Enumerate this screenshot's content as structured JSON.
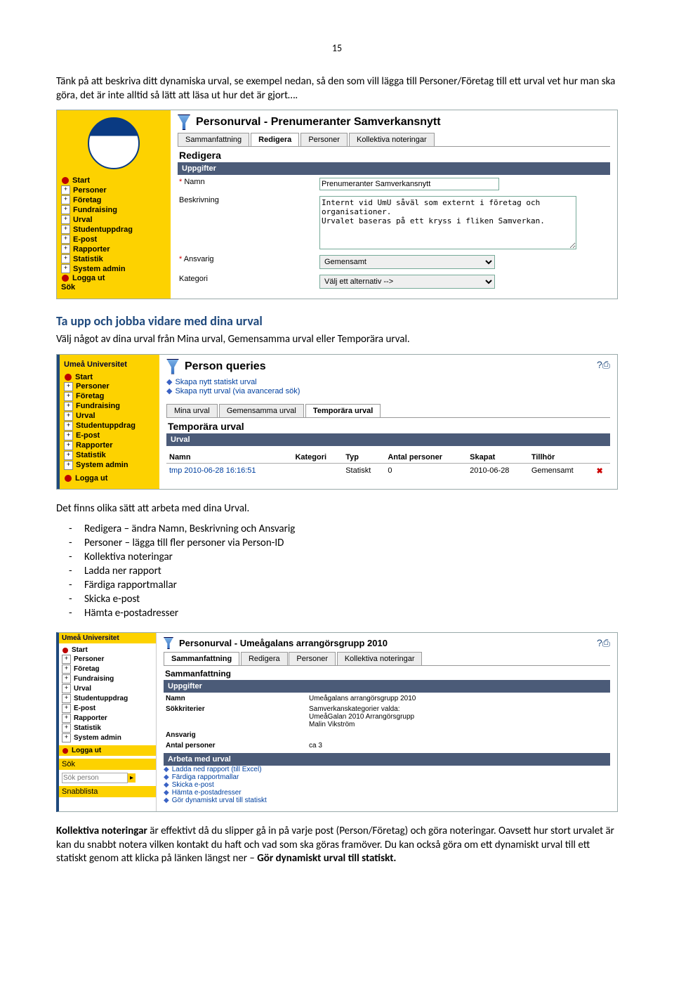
{
  "page_number": "15",
  "intro": "Tänk på att beskriva ditt dynamiska urval, se exempel nedan, så den som vill lägga till Personer/Företag till ett urval vet hur man ska göra, det är inte alltid så lätt att läsa ut hur det är gjort….",
  "shot1": {
    "title": "Personurval - Prenumeranter Samverkansnytt",
    "tabs": [
      "Sammanfattning",
      "Redigera",
      "Personer",
      "Kollektiva noteringar"
    ],
    "active_tab": "Redigera",
    "section": "Redigera",
    "bar": "Uppgifter",
    "form": {
      "namn_label": "Namn",
      "namn_value": "Prenumeranter Samverkansnytt",
      "beskr_label": "Beskrivning",
      "beskr_value": "Internt vid UmU såväl som externt i företag och organisationer.\nUrvalet baseras på ett kryss i fliken Samverkan.",
      "ansv_label": "Ansvarig",
      "ansv_value": "Gemensamt",
      "kat_label": "Kategori",
      "kat_value": "Välj ett alternativ -->"
    },
    "nav": [
      "Start",
      "Personer",
      "Företag",
      "Fundraising",
      "Urval",
      "Studentuppdrag",
      "E-post",
      "Rapporter",
      "Statistik",
      "System admin",
      "Logga ut",
      "Sök"
    ]
  },
  "heading2": "Ta upp och jobba vidare med dina urval",
  "heading2_text": "Välj något av dina urval från Mina urval, Gemensamma urval eller Temporära urval.",
  "shot2": {
    "brand": "Umeå Universitet",
    "title": "Person queries",
    "links": [
      "Skapa nytt statiskt urval",
      "Skapa nytt urval (via avancerad sök)"
    ],
    "tabs": [
      "Mina urval",
      "Gemensamma urval",
      "Temporära urval"
    ],
    "active_tab": "Temporära urval",
    "section": "Temporära urval",
    "bar": "Urval",
    "cols": [
      "Namn",
      "Kategori",
      "Typ",
      "Antal personer",
      "Skapat",
      "Tillhör"
    ],
    "row": {
      "namn": "tmp 2010-06-28 16:16:51",
      "kategori": "",
      "typ": "Statiskt",
      "antal": "0",
      "skapat": "2010-06-28",
      "tillhor": "Gemensamt"
    },
    "nav": [
      "Start",
      "Personer",
      "Företag",
      "Fundraising",
      "Urval",
      "Studentuppdrag",
      "E-post",
      "Rapporter",
      "Statistik",
      "System admin",
      "Logga ut"
    ]
  },
  "midtext": "Det finns olika sätt att arbeta med dina Urval.",
  "bullets": [
    "Redigera – ändra Namn, Beskrivning och Ansvarig",
    "Personer – lägga till fler personer via Person-ID",
    "Kollektiva noteringar",
    "Ladda ner rapport",
    "Färdiga rapportmallar",
    "Skicka e-post",
    "Hämta e-postadresser"
  ],
  "shot3": {
    "brand": "Umeå Universitet",
    "title": "Personurval - Umeågalans arrangörsgrupp 2010",
    "tabs": [
      "Sammanfattning",
      "Redigera",
      "Personer",
      "Kollektiva noteringar"
    ],
    "active_tab": "Sammanfattning",
    "section": "Sammanfattning",
    "bar1": "Uppgifter",
    "rows": [
      [
        "Namn",
        "Umeågalans arrangörsgrupp 2010"
      ],
      [
        "Sökkriterier",
        "Samverkanskategorier valda:\nUmeåGalan 2010 Arrangörsgrupp\nMalin Vikström"
      ],
      [
        "Ansvarig",
        ""
      ],
      [
        "Antal personer",
        "ca 3"
      ]
    ],
    "bar2": "Arbeta med urval",
    "links": [
      "Ladda ned rapport (till Excel)",
      "Färdiga rapportmallar",
      "Skicka e-post",
      "Hämta e-postadresser",
      "Gör dynamiskt urval till statiskt"
    ],
    "nav": [
      "Start",
      "Personer",
      "Företag",
      "Fundraising",
      "Urval",
      "Studentuppdrag",
      "E-post",
      "Rapporter",
      "Statistik",
      "System admin",
      "Logga ut"
    ],
    "search_label": "Sök",
    "search_placeholder": "Sök person",
    "snabb": "Snabblista"
  },
  "footer_strong": "Kollektiva noteringar",
  "footer_body": " är effektivt då du slipper gå in på varje post (Person/Företag) och göra noteringar. Oavsett hur stort urvalet är kan du snabbt notera vilken kontakt du haft och vad som ska göras framöver. Du kan också göra om ett dynamiskt urval till ett statiskt genom att klicka på länken längst ner – ",
  "footer_strong2": "Gör dynamiskt urval till statiskt."
}
